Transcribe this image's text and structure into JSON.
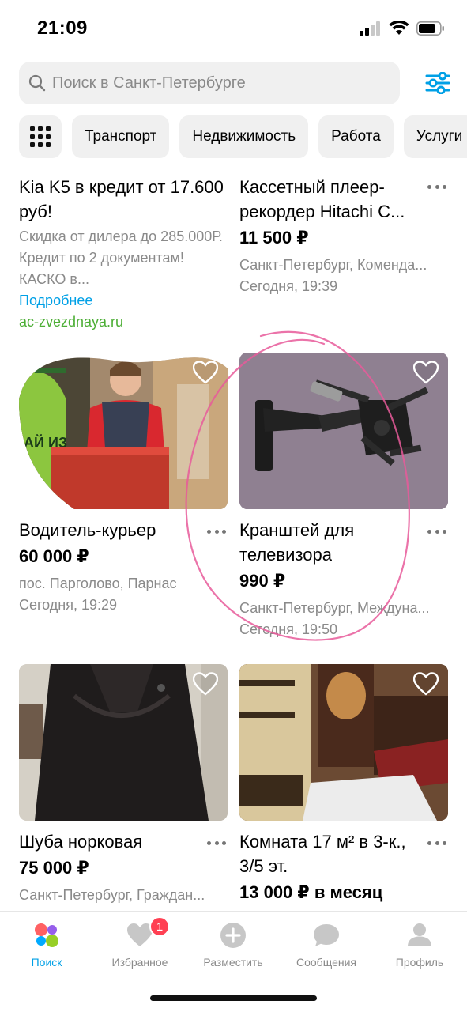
{
  "status": {
    "time": "21:09"
  },
  "search": {
    "placeholder": "Поиск в Санкт-Петербурге"
  },
  "categories": [
    "Транспорт",
    "Недвижимость",
    "Работа",
    "Услуги"
  ],
  "listings": [
    {
      "kind": "ad",
      "title": "Kia K5 в кредит от 17.600 руб!",
      "description": "Скидка от дилера до 285.000Р. Кредит по 2 документам! КАСКО в...",
      "link": "Подробнее",
      "domain": "ac-zvezdnaya.ru"
    },
    {
      "title": "Кассетный плеер-рекордер Hitachi C...",
      "price": "11 500 ₽",
      "location": "Санкт-Петербург, Коменда...",
      "date": "Сегодня, 19:39"
    },
    {
      "title": "Водитель-курьер",
      "price": "60 000 ₽",
      "location": "пос. Парголово, Парнас",
      "date": "Сегодня, 19:29",
      "image_text": "АЙ ИЗ"
    },
    {
      "title": "Кранштей для телевизора",
      "price": "990 ₽",
      "location": "Санкт-Петербург, Междуна...",
      "date": "Сегодня, 19:50"
    },
    {
      "title": "Шуба норковая",
      "price": "75 000 ₽",
      "location": "Санкт-Петербург, Граждан..."
    },
    {
      "title": "Комната 17 м² в 3-к., 3/5 эт.",
      "price": "13 000 ₽ в месяц"
    }
  ],
  "tabs": [
    {
      "label": "Поиск",
      "icon": "search-tab-icon",
      "active": true
    },
    {
      "label": "Избранное",
      "icon": "heart-tab-icon",
      "badge": "1"
    },
    {
      "label": "Разместить",
      "icon": "plus-tab-icon"
    },
    {
      "label": "Сообщения",
      "icon": "chat-tab-icon"
    },
    {
      "label": "Профиль",
      "icon": "profile-tab-icon"
    }
  ],
  "colors": {
    "accent": "#00a0e6",
    "price": "#000000",
    "muted": "#8a8a8a",
    "badge": "#ff4053",
    "ad_domain": "#4cae35",
    "annotation": "#e85a9a"
  }
}
